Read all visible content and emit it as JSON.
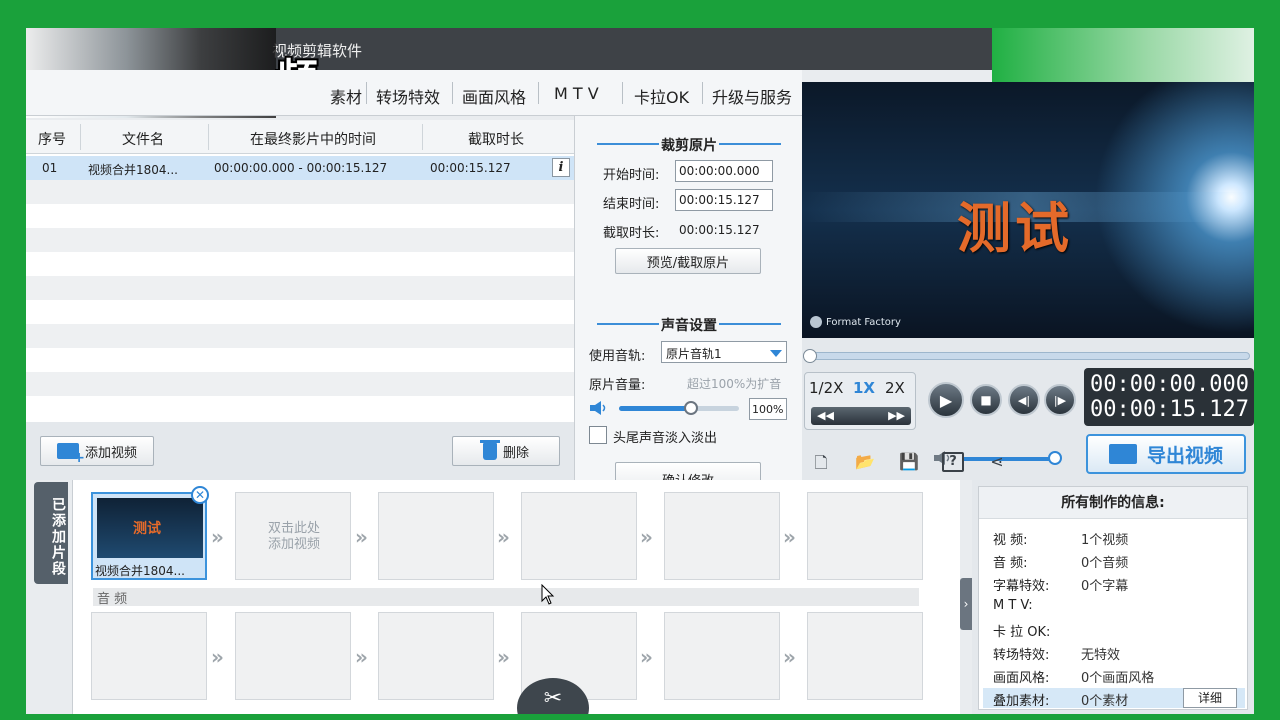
{
  "window": {
    "title": "视频剪辑软件",
    "logo_glyph": "频"
  },
  "menu": {
    "items": [
      "素材",
      "转场特效",
      "画面风格",
      "M T V",
      "卡拉OK",
      "升级与服务"
    ]
  },
  "table": {
    "headers": [
      "序号",
      "文件名",
      "在最终影片中的时间",
      "截取时长"
    ],
    "rows": [
      {
        "index": "01",
        "filename": "视频合并1804...",
        "range": "00:00:00.000 - 00:00:15.127",
        "duration": "00:00:15.127"
      }
    ],
    "info_button": "i"
  },
  "left_buttons": {
    "add_video": "添加视频",
    "delete": "删除"
  },
  "trim": {
    "title": "裁剪原片",
    "start_label": "开始时间:",
    "start_value": "00:00:00.000",
    "end_label": "结束时间:",
    "end_value": "00:00:15.127",
    "duration_label": "截取时长:",
    "duration_value": "00:00:15.127",
    "preview_button": "预览/截取原片"
  },
  "sound": {
    "title": "声音设置",
    "track_label": "使用音轨:",
    "track_value": "原片音轨1",
    "volume_label": "原片音量:",
    "volume_hint": "超过100%为扩音",
    "volume_value": "100%",
    "volume_fraction": 0.6,
    "fade_label": "头尾声音淡入淡出",
    "confirm_button": "确认修改"
  },
  "player": {
    "video_caption": "测试",
    "watermark": "Format Factory",
    "speeds": [
      "1/2X",
      "1X",
      "2X"
    ],
    "current_time": "00:00:00.000",
    "total_time": "00:00:15.127",
    "export_button": "导出视频"
  },
  "timeline": {
    "tab_label": "已添加片段",
    "first_clip": {
      "caption": "视频合并1804...",
      "thumb_text": "测试"
    },
    "add_hint_line1": "双击此处",
    "add_hint_line2": "添加视频",
    "audio_label": "音 频"
  },
  "info": {
    "title": "所有制作的信息:",
    "rows": [
      {
        "k": "视    频:",
        "v": "1个视频"
      },
      {
        "k": "音    频:",
        "v": "0个音频"
      },
      {
        "k": "字幕特效:",
        "v": "0个字幕"
      },
      {
        "k": "M  T  V:",
        "v": ""
      },
      {
        "k": "卡 拉 OK:",
        "v": ""
      },
      {
        "k": "转场特效:",
        "v": "无特效"
      },
      {
        "k": "画面风格:",
        "v": "0个画面风格"
      },
      {
        "k": "叠加素材:",
        "v": "0个素材"
      }
    ],
    "detail_button": "详细"
  },
  "colors": {
    "accent": "#2f86d6",
    "chroma_background": "#1aa13b",
    "caption": "#e46a2a"
  }
}
